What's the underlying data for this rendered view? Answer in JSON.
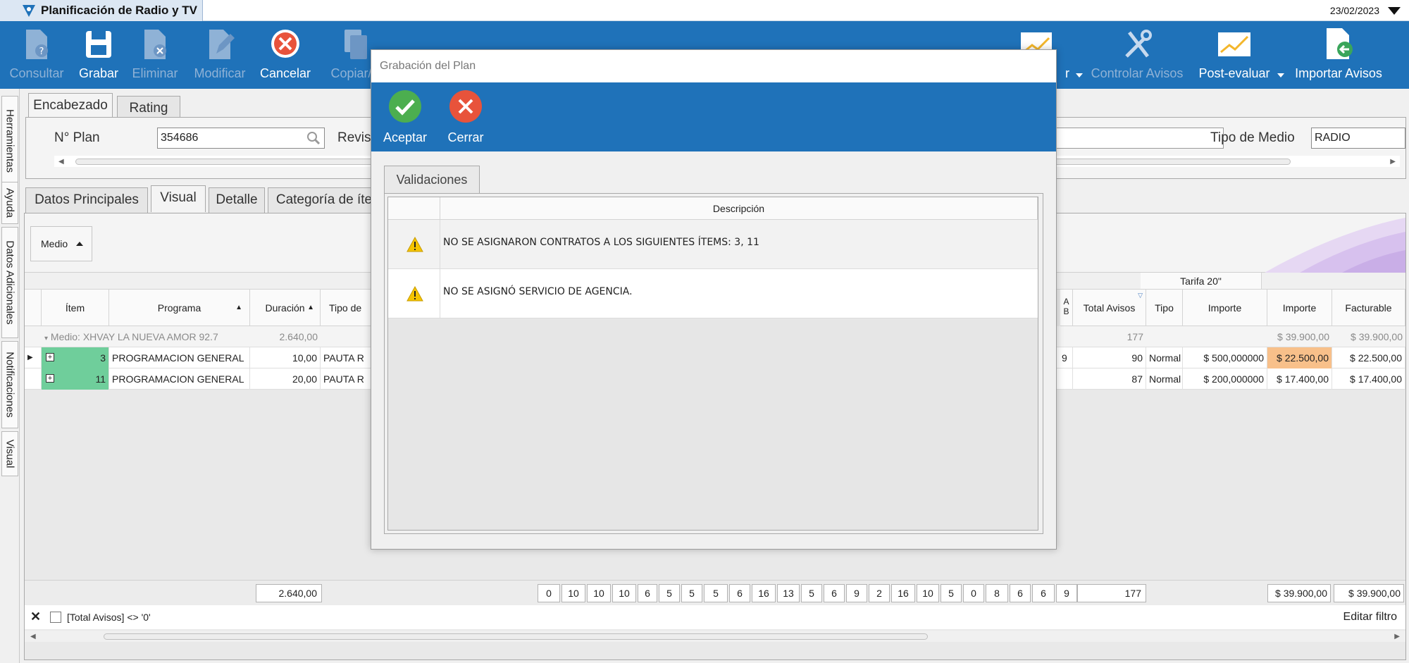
{
  "app": {
    "title": "Planificación de Radio y TV",
    "date": "23/02/2023"
  },
  "ribbon": {
    "buttons": [
      {
        "label": "Consultar",
        "icon": "document-search-icon",
        "enabled": false
      },
      {
        "label": "Grabar",
        "icon": "save-disk-icon",
        "enabled": true
      },
      {
        "label": "Eliminar",
        "icon": "document-delete-icon",
        "enabled": false
      },
      {
        "label": "Modificar",
        "icon": "document-edit-icon",
        "enabled": false
      },
      {
        "label": "Cancelar",
        "icon": "cancel-circle-icon",
        "enabled": true
      },
      {
        "label": "Copiar/M",
        "icon": "copy-icon",
        "enabled": false
      },
      {
        "label": "r",
        "icon": "chart-icon",
        "enabled": true
      },
      {
        "label": "Controlar Avisos",
        "icon": "tools-icon",
        "enabled": false
      },
      {
        "label": "Post-evaluar",
        "icon": "chart-icon",
        "enabled": true
      },
      {
        "label": "Importar Avisos",
        "icon": "import-document-icon",
        "enabled": true
      }
    ]
  },
  "sidetabs": [
    "Herramientas",
    "Ayuda",
    "Datos Adicionales",
    "Notificaciones",
    "Visual"
  ],
  "header": {
    "tabs": [
      "Encabezado",
      "Rating"
    ],
    "plan_label": "N° Plan",
    "plan_value": "354686",
    "revision_label": "Revis",
    "tipo_medio_label": "Tipo de Medio",
    "tipo_medio_value": "RADIO"
  },
  "content_tabs": [
    "Datos Principales",
    "Visual",
    "Detalle",
    "Categoría de íte"
  ],
  "grid": {
    "group_button": "Medio",
    "band_tarifa": "Tarifa 20\"",
    "columns": {
      "item": "Ítem",
      "programa": "Programa",
      "duracion": "Duración",
      "tipo_de": "Tipo de",
      "a_b_1": "A",
      "a_b_2": "B",
      "total_avisos": "Total Avisos",
      "tipo": "Tipo",
      "importe": "Importe",
      "importe2": "Importe",
      "facturable": "Facturable"
    },
    "group_row": {
      "label": "Medio: XHVAY LA NUEVA AMOR 92.7",
      "duracion": "2.640,00",
      "total_avisos": "177",
      "importe2": "$ 39.900,00",
      "facturable": "$ 39.900,00"
    },
    "rows": [
      {
        "item": "3",
        "programa": "PROGRAMACION GENERAL",
        "duracion": "10,00",
        "tipo_de": "PAUTA R",
        "a_b": "9",
        "total_avisos": "90",
        "tipo": "Normal",
        "importe": "$ 500,000000",
        "importe2": "$ 22.500,00",
        "facturable": "$ 22.500,00"
      },
      {
        "item": "11",
        "programa": "PROGRAMACION GENERAL",
        "duracion": "20,00",
        "tipo_de": "PAUTA R",
        "a_b": "",
        "total_avisos": "87",
        "tipo": "Normal",
        "importe": "$ 200,000000",
        "importe2": "$ 17.400,00",
        "facturable": "$ 17.400,00"
      }
    ],
    "footer": {
      "duracion": "2.640,00",
      "day_totals": [
        "0",
        "10",
        "10",
        "10",
        "6",
        "5",
        "5",
        "5",
        "6",
        "16",
        "13",
        "5",
        "6",
        "9",
        "2",
        "16",
        "10",
        "5",
        "0",
        "8",
        "6",
        "6",
        "9",
        "9"
      ],
      "total_avisos": "177",
      "importe2": "$ 39.900,00",
      "facturable": "$ 39.900,00"
    },
    "filter_text": "[Total Avisos] <> '0'",
    "edit_filter": "Editar filtro"
  },
  "dialog": {
    "title": "Grabación del Plan",
    "accept": "Aceptar",
    "close": "Cerrar",
    "tab": "Validaciones",
    "column": "Descripción",
    "messages": [
      "NO SE ASIGNARON CONTRATOS A LOS SIGUIENTES ÍTEMS: 3, 11",
      "NO SE ASIGNÓ SERVICIO DE AGENCIA."
    ]
  },
  "colors": {
    "ribbon": "#1f72b9",
    "highlight": "#f8c08a",
    "item_green": "#6fce9b",
    "warning": "#f5c400"
  }
}
